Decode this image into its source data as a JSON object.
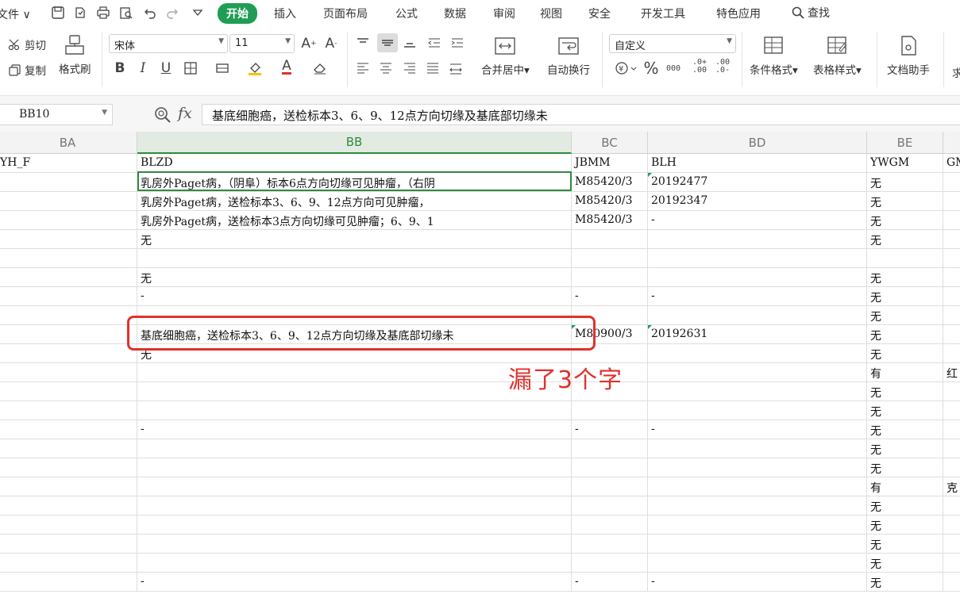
{
  "menu": {
    "file": "文件 ∨",
    "tabs": [
      "开始",
      "插入",
      "页面布局",
      "公式",
      "数据",
      "审阅",
      "视图",
      "安全",
      "开发工具",
      "特色应用"
    ],
    "find": "查找"
  },
  "ribbon": {
    "cut": "剪切",
    "copy": "复制",
    "format_painter": "格式刷",
    "font_name": "宋体",
    "font_size": "11",
    "bold": "B",
    "italic": "I",
    "underline": "U",
    "merge_center": "合并居中",
    "wrap_text": "自动换行",
    "number_format": "自定义",
    "percent": "%",
    "thousands": "000",
    "dec_inc": ".0+\n.00",
    "dec_dec": ".00\n.0-",
    "conditional_format": "条件格式",
    "table_style": "表格样式",
    "doc_assistant": "文档助手",
    "partial": "求"
  },
  "formula_bar": {
    "name_box": "BB10",
    "fx": "fx",
    "formula": "基底细胞癌，送检标本3、6、9、12点方向切缘及基底部切缘未"
  },
  "columns": [
    "BA",
    "BB",
    "BC",
    "BD",
    "BE"
  ],
  "rows": [
    [
      "YH_F",
      "BLZD",
      "JBMM",
      "BLH",
      "YWGM",
      "GM"
    ],
    [
      "",
      "乳房外Paget病，（阴阜）标本6点方向切缘可见肿瘤，（右阴",
      "M85420/3",
      "20192477",
      "无",
      ""
    ],
    [
      "",
      "乳房外Paget病，送检标本3、6、9、12点方向可见肿瘤，",
      "M85420/3",
      "20192347",
      "无",
      ""
    ],
    [
      "",
      "乳房外Paget病，送检标本3点方向切缘可见肿瘤；6、9、1",
      "M85420/3",
      "-",
      "无",
      ""
    ],
    [
      "",
      "无",
      "",
      "",
      "无",
      ""
    ],
    [
      "",
      "",
      "",
      "",
      "",
      ""
    ],
    [
      "",
      "无",
      "",
      "",
      "无",
      ""
    ],
    [
      "",
      "-",
      "-",
      "-",
      "无",
      ""
    ],
    [
      "",
      "",
      "",
      "",
      "无",
      ""
    ],
    [
      "",
      "基底细胞癌，送检标本3、6、9、12点方向切缘及基底部切缘未",
      "M80900/3",
      "20192631",
      "无",
      ""
    ],
    [
      "",
      "无",
      "",
      "",
      "无",
      ""
    ],
    [
      "",
      "",
      "",
      "",
      "有",
      "红"
    ],
    [
      "",
      "",
      "",
      "",
      "无",
      ""
    ],
    [
      "",
      "",
      "",
      "",
      "无",
      ""
    ],
    [
      "",
      "-",
      "-",
      "-",
      "无",
      ""
    ],
    [
      "",
      "",
      "",
      "",
      "无",
      ""
    ],
    [
      "",
      "",
      "",
      "",
      "无",
      ""
    ],
    [
      "",
      "",
      "",
      "",
      "有",
      "克"
    ],
    [
      "",
      "",
      "",
      "",
      "无",
      ""
    ],
    [
      "",
      "",
      "",
      "",
      "无",
      ""
    ],
    [
      "",
      "",
      "",
      "",
      "无",
      ""
    ],
    [
      "",
      "",
      "",
      "",
      "无",
      ""
    ],
    [
      "",
      "-",
      "-",
      "-",
      "无",
      ""
    ]
  ],
  "annotation": "漏了3个字",
  "colors": {
    "accent": "#1f9d55",
    "annotation_red": "#e0312c",
    "selected_header": "#2e8b3e"
  }
}
